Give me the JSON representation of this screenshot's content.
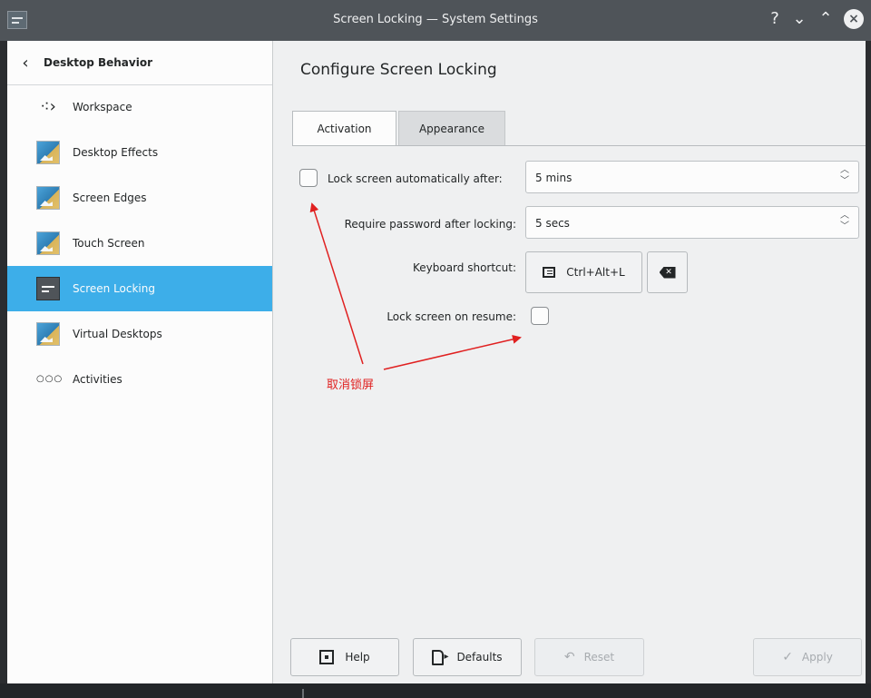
{
  "window": {
    "title": "Screen Locking — System Settings",
    "controls": {
      "help": "?",
      "minimize": "⌄",
      "maximize": "⌃",
      "close": "×"
    }
  },
  "sidebar": {
    "header": "Desktop Behavior",
    "items": [
      {
        "label": "Workspace",
        "icon": "workspace-icon"
      },
      {
        "label": "Desktop Effects",
        "icon": "desktop-effects-icon"
      },
      {
        "label": "Screen Edges",
        "icon": "screen-edges-icon"
      },
      {
        "label": "Touch Screen",
        "icon": "touch-screen-icon"
      },
      {
        "label": "Screen Locking",
        "icon": "screen-locking-icon",
        "active": true
      },
      {
        "label": "Virtual Desktops",
        "icon": "virtual-desktops-icon"
      },
      {
        "label": "Activities",
        "icon": "activities-icon"
      }
    ]
  },
  "main": {
    "title": "Configure Screen Locking",
    "tabs": [
      {
        "label": "Activation",
        "active": true
      },
      {
        "label": "Appearance",
        "active": false
      }
    ],
    "form": {
      "lock_auto_label": "Lock screen automatically after:",
      "lock_auto_checked": false,
      "lock_auto_value": "5 mins",
      "require_password_label": "Require password after locking:",
      "require_password_value": "5 secs",
      "shortcut_label": "Keyboard shortcut:",
      "shortcut_value": "Ctrl+Alt+L",
      "lock_resume_label": "Lock screen on resume:",
      "lock_resume_checked": false
    },
    "annotation": "取消锁屏"
  },
  "footer": {
    "help": "Help",
    "defaults": "Defaults",
    "reset": "Reset",
    "apply": "Apply"
  },
  "colors": {
    "accent": "#3daee9",
    "annotation": "#e02020",
    "titlebar": "#4f5459"
  }
}
